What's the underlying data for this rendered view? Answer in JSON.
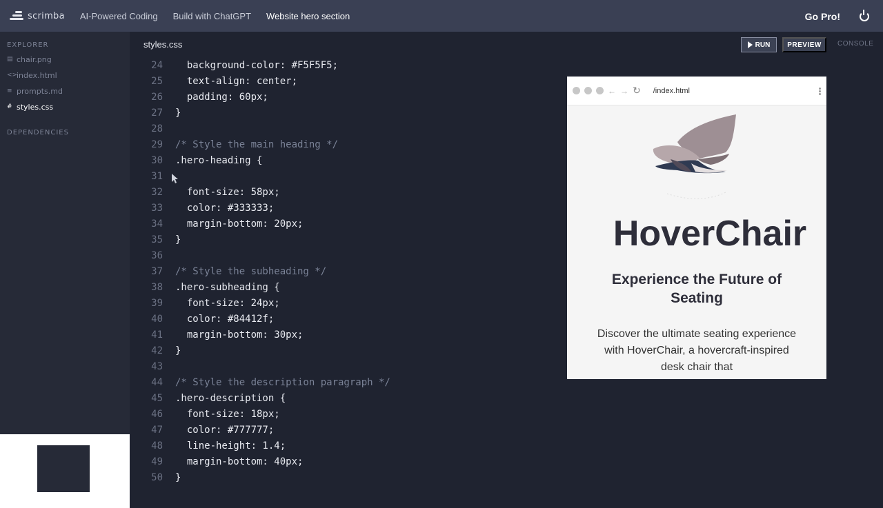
{
  "app": {
    "logo_text": "scrimba",
    "breadcrumbs": [
      "AI-Powered Coding",
      "Build with ChatGPT",
      "Website hero section"
    ],
    "gopro_label": "Go Pro!"
  },
  "sidebar": {
    "explorer_label": "EXPLORER",
    "files": [
      {
        "icon": "image",
        "name": "chair.png",
        "active": false
      },
      {
        "icon": "code",
        "name": "index.html",
        "active": false
      },
      {
        "icon": "doc",
        "name": "prompts.md",
        "active": false
      },
      {
        "icon": "hash",
        "name": "styles.css",
        "active": true
      }
    ],
    "dependencies_label": "DEPENDENCIES"
  },
  "editor": {
    "file_tab": "styles.css",
    "run_label": "RUN",
    "preview_label": "PREVIEW",
    "console_label": "CONSOLE",
    "lines": [
      {
        "n": "24",
        "t": "  background-color: #F5F5F5;"
      },
      {
        "n": "25",
        "t": "  text-align: center;"
      },
      {
        "n": "26",
        "t": "  padding: 60px;"
      },
      {
        "n": "27",
        "t": "}"
      },
      {
        "n": "28",
        "t": ""
      },
      {
        "n": "29",
        "t": "/* Style the main heading */",
        "c": true
      },
      {
        "n": "30",
        "t": ".hero-heading {"
      },
      {
        "n": "31",
        "t": ""
      },
      {
        "n": "32",
        "t": "  font-size: 58px;"
      },
      {
        "n": "33",
        "t": "  color: #333333;"
      },
      {
        "n": "34",
        "t": "  margin-bottom: 20px;"
      },
      {
        "n": "35",
        "t": "}"
      },
      {
        "n": "36",
        "t": ""
      },
      {
        "n": "37",
        "t": "/* Style the subheading */",
        "c": true
      },
      {
        "n": "38",
        "t": ".hero-subheading {"
      },
      {
        "n": "39",
        "t": "  font-size: 24px;"
      },
      {
        "n": "40",
        "t": "  color: #84412f;"
      },
      {
        "n": "41",
        "t": "  margin-bottom: 30px;"
      },
      {
        "n": "42",
        "t": "}"
      },
      {
        "n": "43",
        "t": ""
      },
      {
        "n": "44",
        "t": "/* Style the description paragraph */",
        "c": true
      },
      {
        "n": "45",
        "t": ".hero-description {"
      },
      {
        "n": "46",
        "t": "  font-size: 18px;"
      },
      {
        "n": "47",
        "t": "  color: #777777;"
      },
      {
        "n": "48",
        "t": "  line-height: 1.4;"
      },
      {
        "n": "49",
        "t": "  margin-bottom: 40px;"
      },
      {
        "n": "50",
        "t": "}"
      }
    ]
  },
  "preview": {
    "url": "/index.html",
    "heading": "HoverChair",
    "subheading": "Experience the Future of Seating",
    "description": "Discover the ultimate seating experience with HoverChair, a hovercraft-inspired desk chair that"
  }
}
